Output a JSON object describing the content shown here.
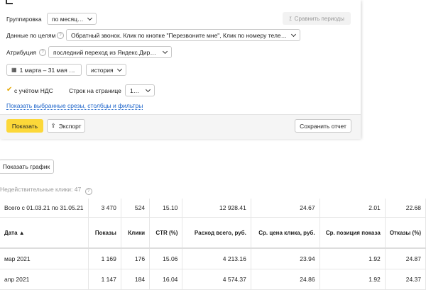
{
  "filters": {
    "grouping_label": "Группировка",
    "grouping_value": "по месяцам",
    "compare_button": "Сравнить периоды",
    "goals_label": "Данные по целям",
    "goals_value": "Обратный звонок. Клик по кнопке \"Перезвоните мне\", Клик по номеру телеф...",
    "attribution_label": "Атрибуция",
    "attribution_value": "последний переход из Яндекс.Директа",
    "date_range": "1 марта – 31 мая 2021",
    "history_value": "история",
    "vat_label": "с учётом НДС",
    "rows_label": "Строк на странице",
    "rows_value": "1000",
    "show_slices_link": "Показать выбранные срезы, столбцы и фильтры"
  },
  "actions": {
    "show": "Показать",
    "export": "Экспорт",
    "save_report": "Сохранить отчет",
    "show_chart": "Показать график"
  },
  "note": "Недействительные клики: 47",
  "table": {
    "total": [
      "Всего с 01.03.21 по 31.05.21",
      "3 470",
      "524",
      "15.10",
      "12 928.41",
      "24.67",
      "2.01",
      "22.68"
    ],
    "headers": [
      "Дата ▲",
      "Показы",
      "Клики",
      "CTR (%)",
      "Расход всего, руб.",
      "Ср. цена клика, руб.",
      "Ср. позиция показа",
      "Отказы (%)"
    ],
    "rows": [
      [
        "мар 2021",
        "1 169",
        "176",
        "15.06",
        "4 213.16",
        "23.94",
        "1.92",
        "24.87"
      ],
      [
        "апр 2021",
        "1 147",
        "184",
        "16.04",
        "4 574.37",
        "24.86",
        "1.92",
        "24.37"
      ]
    ]
  },
  "colors": {
    "accent": "#fcd839",
    "link": "#1a62c9"
  }
}
